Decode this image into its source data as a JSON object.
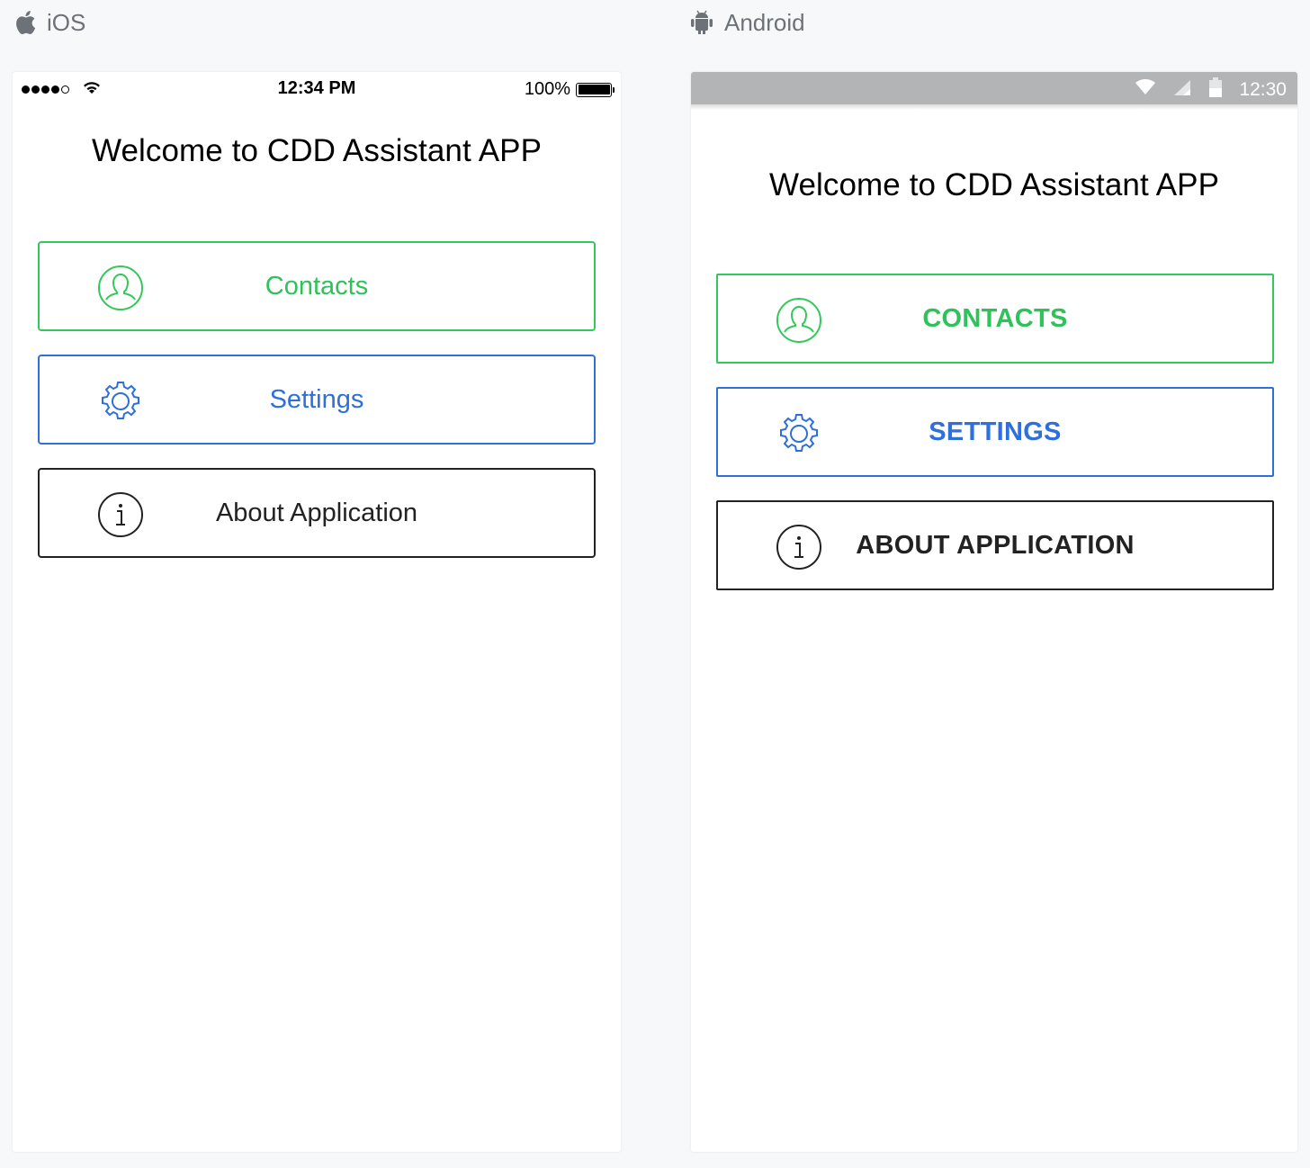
{
  "platforms": {
    "ios": {
      "label": "iOS",
      "icon": "apple-icon"
    },
    "android": {
      "label": "Android",
      "icon": "android-icon"
    }
  },
  "ios_screen": {
    "status_bar": {
      "time": "12:34 PM",
      "battery": "100%",
      "battery_level": 1.0,
      "signal_bars": 4
    },
    "title": "Welcome to CDD Assistant APP",
    "buttons": [
      {
        "label": "Contacts",
        "icon": "user-icon",
        "color": "#34c759"
      },
      {
        "label": "Settings",
        "icon": "gear-icon",
        "color": "#2f6fd8"
      },
      {
        "label": "About Application",
        "icon": "info-icon",
        "color": "#222222"
      }
    ]
  },
  "android_screen": {
    "status_bar": {
      "time": "12:30"
    },
    "title": "Welcome to CDD Assistant APP",
    "buttons": [
      {
        "label": "CONTACTS",
        "icon": "user-icon",
        "color": "#34c759"
      },
      {
        "label": "SETTINGS",
        "icon": "gear-icon",
        "color": "#2f6fd8"
      },
      {
        "label": "ABOUT APPLICATION",
        "icon": "info-icon",
        "color": "#222222"
      }
    ]
  }
}
